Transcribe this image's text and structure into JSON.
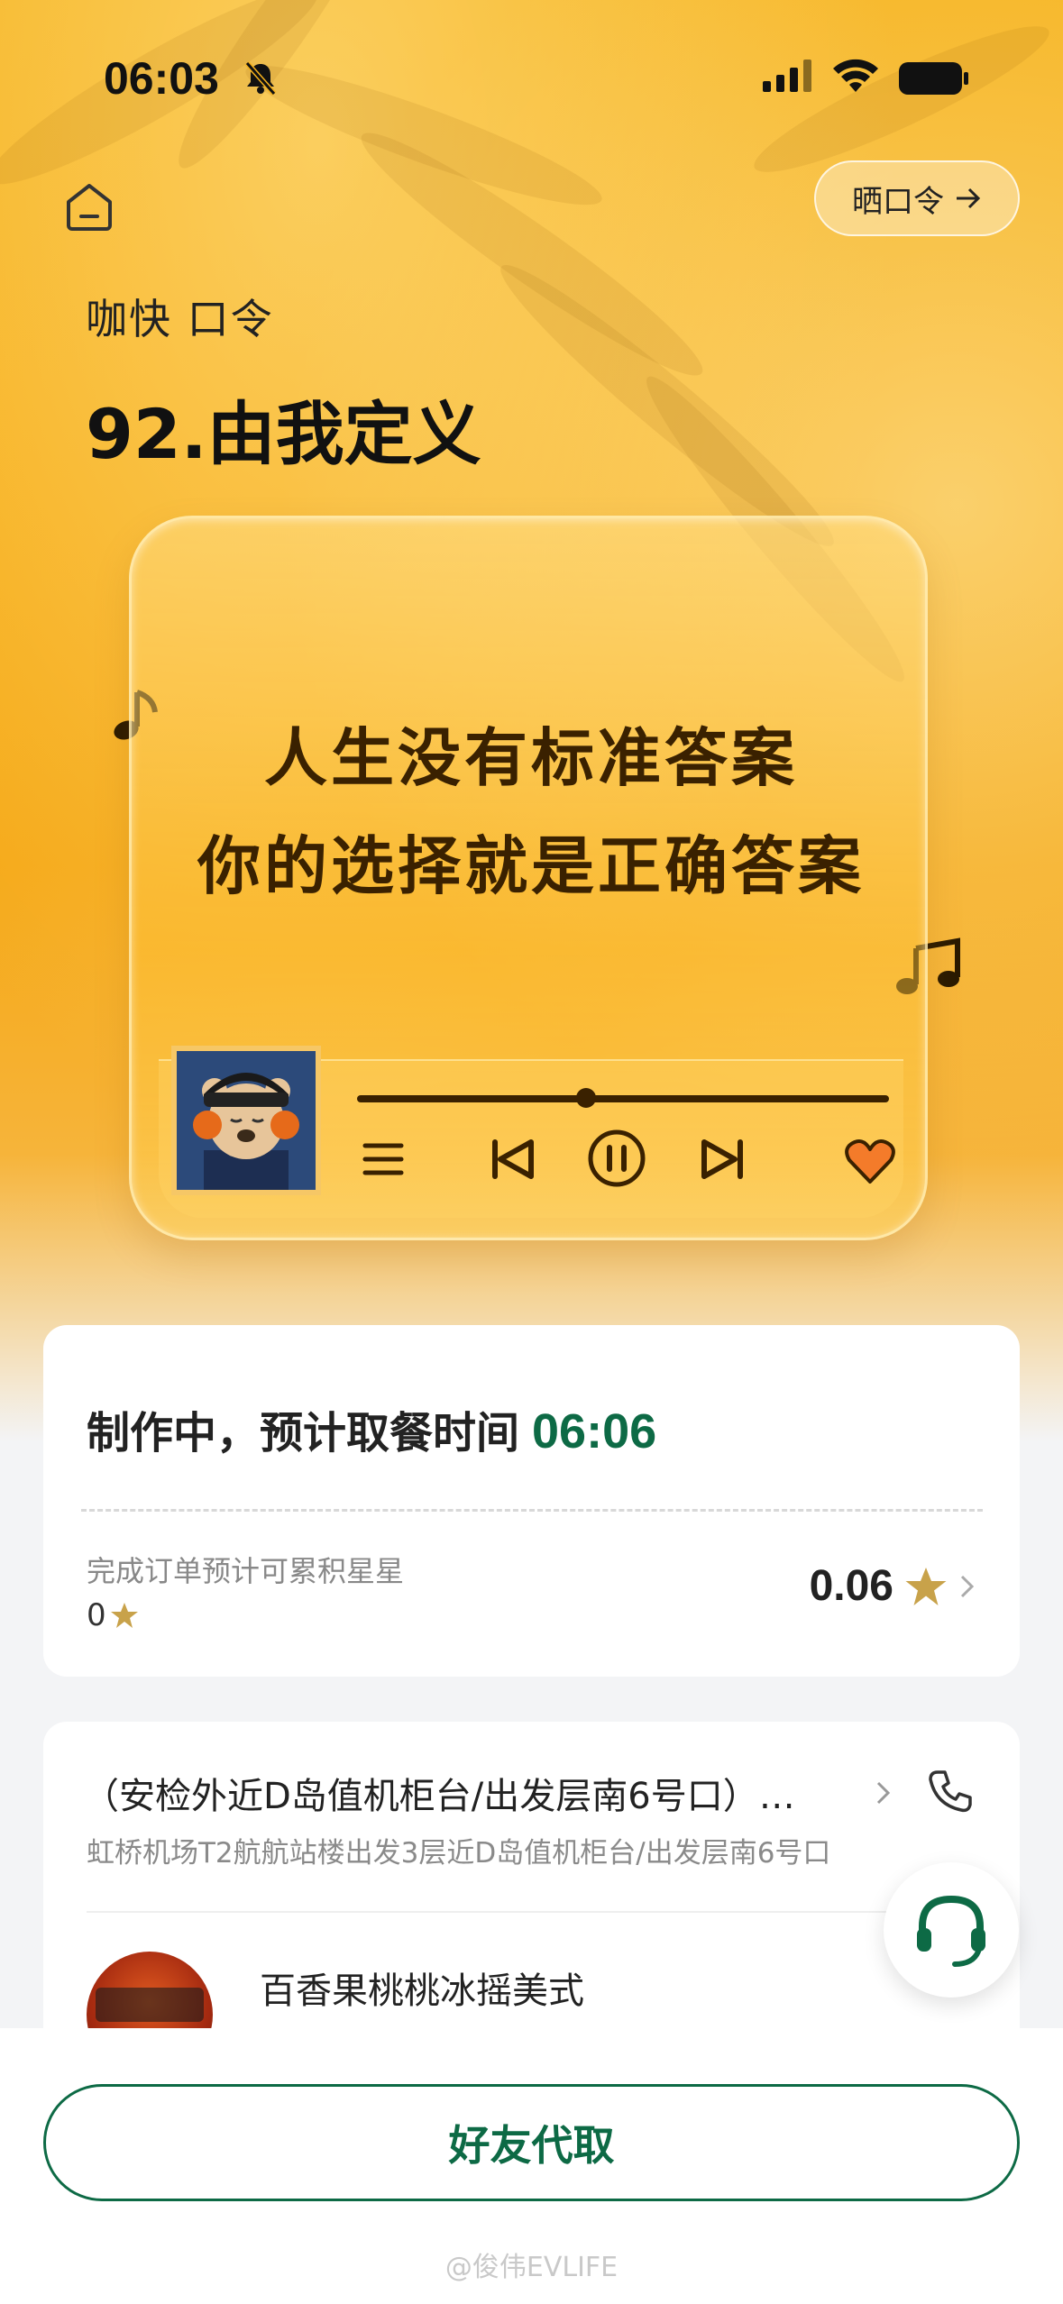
{
  "status_bar": {
    "time": "06:03"
  },
  "header": {
    "share_label": "晒口令",
    "brand": "咖快 口令",
    "title": "92.由我定义"
  },
  "lyric_card": {
    "line1": "人生没有标准答案",
    "line2": "你的选择就是正确答案",
    "progress": 0.43
  },
  "order_status": {
    "prefix": "制作中，预计取餐时间",
    "pickup_time": "06:06",
    "accum_label": "完成订单预计可累积星星",
    "current_stars": "0",
    "stars_value": "0.06"
  },
  "store": {
    "name": "（安检外近D岛值机柜台/出发层南6号口）…",
    "address": "虹桥机场T2航航站楼出发3层近D岛值机柜台/出发层南6号口"
  },
  "product": {
    "name": "百香果桃桃冰摇美式"
  },
  "actions": {
    "friend_pickup": "好友代取"
  },
  "watermark": "@俊伟EVLIFE",
  "colors": {
    "brand_green": "#0d6a45",
    "hero_orange": "#f6b21c",
    "star_gold": "#c8a24a"
  }
}
